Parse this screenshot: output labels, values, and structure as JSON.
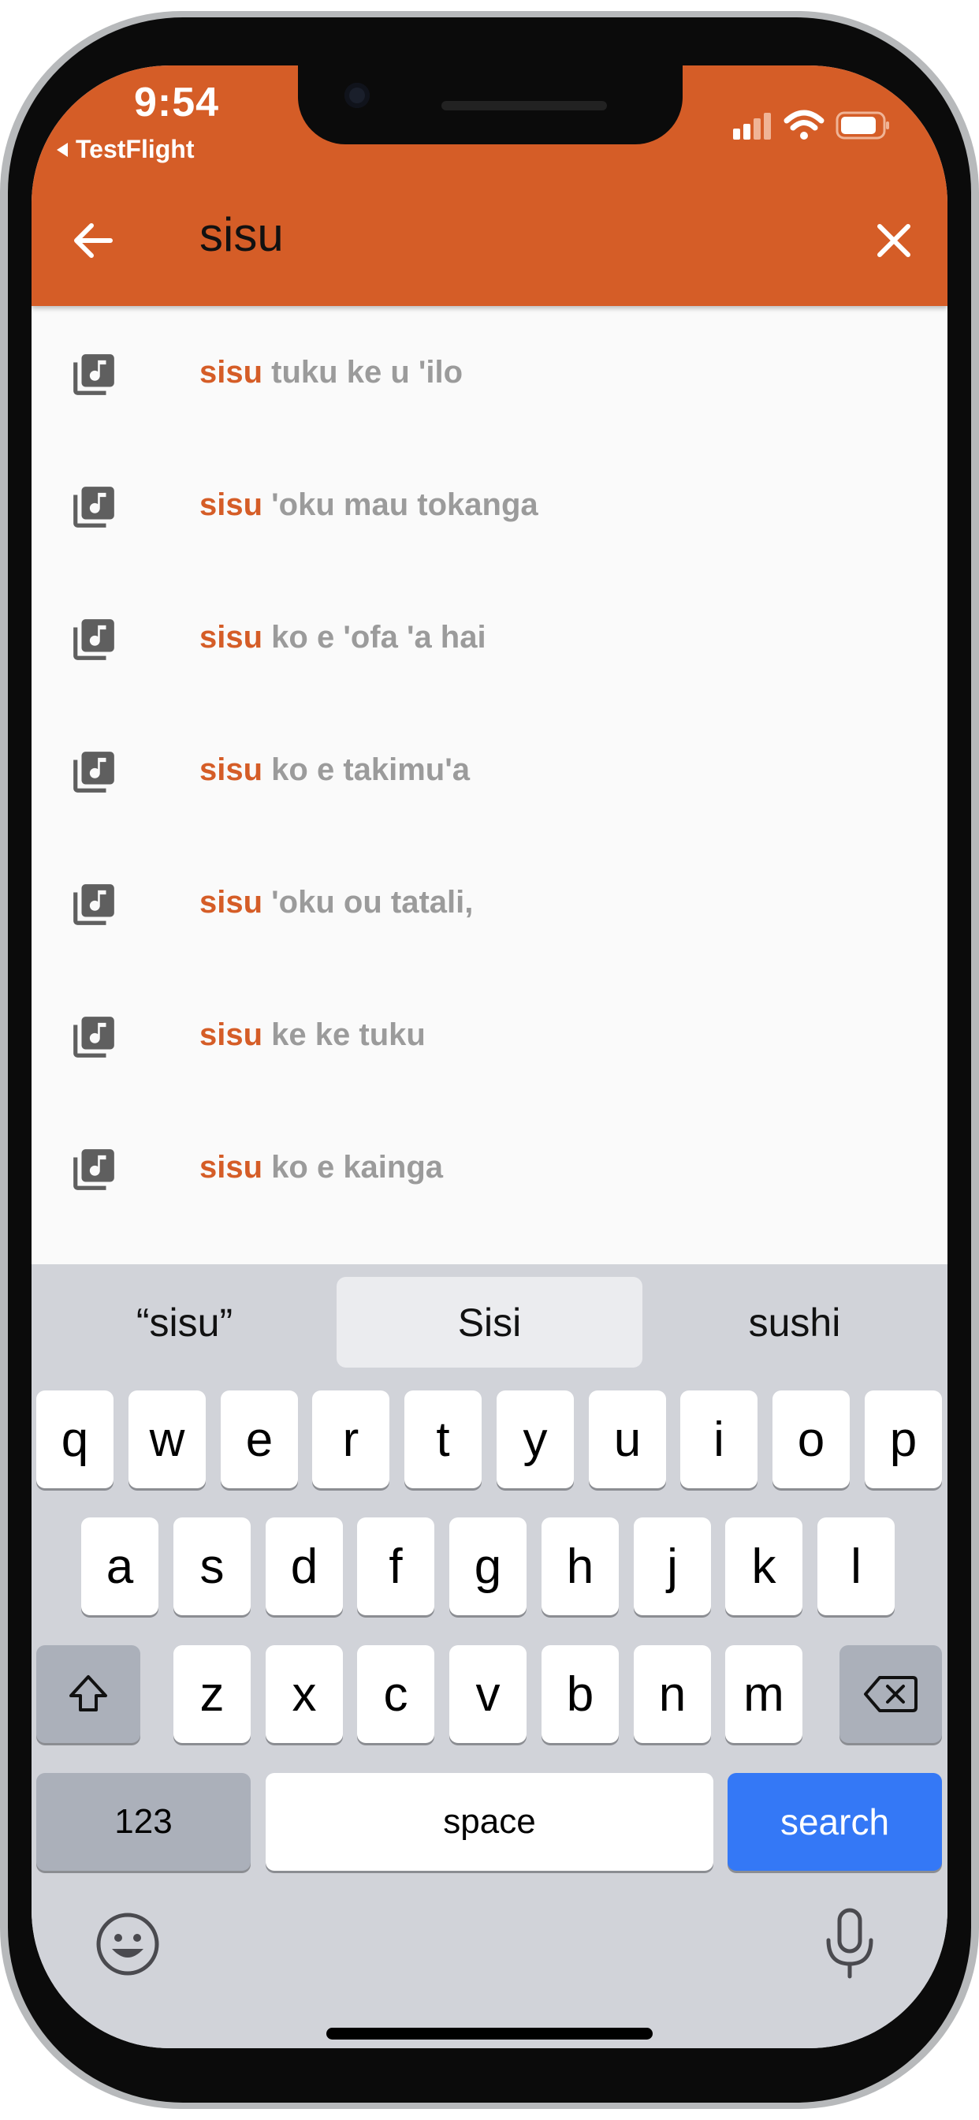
{
  "status_bar": {
    "time": "9:54",
    "back_app": "TestFlight",
    "icons": [
      "signal-icon",
      "wifi-icon",
      "battery-icon"
    ]
  },
  "header": {
    "query": "sisu",
    "back_icon": "arrow-left-icon",
    "clear_icon": "close-icon",
    "color": "#d55d27"
  },
  "results": [
    {
      "match": "sisu",
      "rest": " tuku ke u 'ilo"
    },
    {
      "match": "sisu",
      "rest": " 'oku mau tokanga"
    },
    {
      "match": "sisu",
      "rest": " ko e 'ofa 'a hai"
    },
    {
      "match": "sisu",
      "rest": " ko e takimu'a"
    },
    {
      "match": "sisu",
      "rest": " 'oku ou tatali,"
    },
    {
      "match": "sisu",
      "rest": " ke ke tuku"
    },
    {
      "match": "sisu",
      "rest": " ko e kainga"
    }
  ],
  "keyboard": {
    "suggestions": [
      "“sisu”",
      "Sisi",
      "sushi"
    ],
    "row1": [
      "q",
      "w",
      "e",
      "r",
      "t",
      "y",
      "u",
      "i",
      "o",
      "p"
    ],
    "row2": [
      "a",
      "s",
      "d",
      "f",
      "g",
      "h",
      "j",
      "k",
      "l"
    ],
    "row3": [
      "z",
      "x",
      "c",
      "v",
      "b",
      "n",
      "m"
    ],
    "numbers_label": "123",
    "space_label": "space",
    "search_label": "search",
    "accent": "#3478f6"
  }
}
